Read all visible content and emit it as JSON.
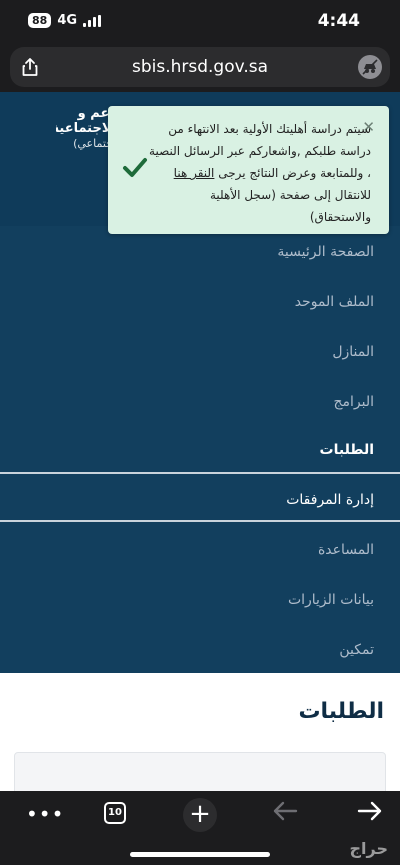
{
  "status_bar": {
    "battery": "88",
    "network": "4G",
    "time": "4:44"
  },
  "browser": {
    "url": "sbis.hrsd.gov.sa"
  },
  "site_header": {
    "logo_line1": "دعم و",
    "logo_line2": "الاجتماعية",
    "logo_line3": "اجتماعي)"
  },
  "toast": {
    "close_icon": "✕",
    "message_part1": "سيتم دراسة أهليتك الأولية بعد الانتهاء من دراسة طلبكم ,واشعاركم عبر الرسائل النصية ، وللمتابعة وعرض النتائج يرجى ",
    "link_text": "النقر هنا",
    "message_part2": " للانتقال إلى صفحة (سجل الأهلية والاستحقاق)",
    "accent_color": "#1e6b3a"
  },
  "menu": {
    "items": [
      "الصفحة الرئيسية",
      "الملف الموحد",
      "المنازل",
      "البرامج",
      "الطلبات",
      "إدارة المرفقات",
      "المساعدة",
      "بيانات الزيارات",
      "تمكين"
    ],
    "active_index": 4
  },
  "content": {
    "title": "الطلبات"
  },
  "toolbar": {
    "more": "•••",
    "tab_count": "10",
    "new_tab": "+"
  },
  "watermark": "حراج"
}
